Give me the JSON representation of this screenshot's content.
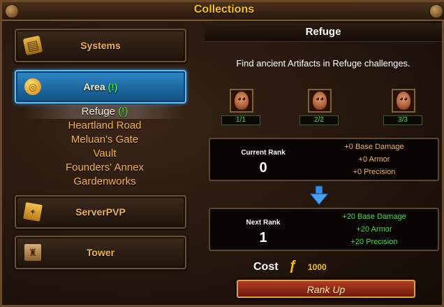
{
  "window": {
    "title": "Collections"
  },
  "sidebar": {
    "categories": [
      {
        "label": "Systems",
        "icon": "book-icon",
        "active": false
      },
      {
        "label": "Area",
        "badge": "(!)",
        "icon": "coin-icon",
        "active": true
      },
      {
        "label": "ServerPVP",
        "icon": "map-scroll-icon",
        "active": false
      },
      {
        "label": "Tower",
        "icon": "tower-icon",
        "active": false
      }
    ],
    "area_items": [
      {
        "label": "Refuge",
        "badge": "(!)",
        "active": true
      },
      {
        "label": "Heartland Road"
      },
      {
        "label": "Meluan's Gate"
      },
      {
        "label": "Vault"
      },
      {
        "label": "Founders' Annex"
      },
      {
        "label": "Gardenworks"
      }
    ]
  },
  "detail": {
    "title": "Refuge",
    "description": "Find ancient Artifacts in Refuge challenges.",
    "artifacts": [
      {
        "count": "1/1",
        "icon": "mask-icon"
      },
      {
        "count": "2/2",
        "icon": "mask-icon"
      },
      {
        "count": "3/3",
        "icon": "mask-icon"
      }
    ],
    "current_rank": {
      "label": "Current Rank",
      "value": "0",
      "bonuses": [
        "+0 Base Damage",
        "+0 Armor",
        "+0 Precision"
      ]
    },
    "next_rank": {
      "label": "Next Rank",
      "value": "1",
      "bonuses": [
        "+20 Base Damage",
        "+20 Armor",
        "+20 Precision"
      ]
    },
    "cost": {
      "label": "Cost",
      "value": "1000",
      "currency_icon": "gold-currency-icon"
    },
    "rank_up_button": "Rank Up"
  },
  "colors": {
    "title_gold": "#f2c020",
    "menu_orange": "#f0b24a",
    "bonus_green": "#40e040",
    "active_blue": "#2d86c7"
  }
}
